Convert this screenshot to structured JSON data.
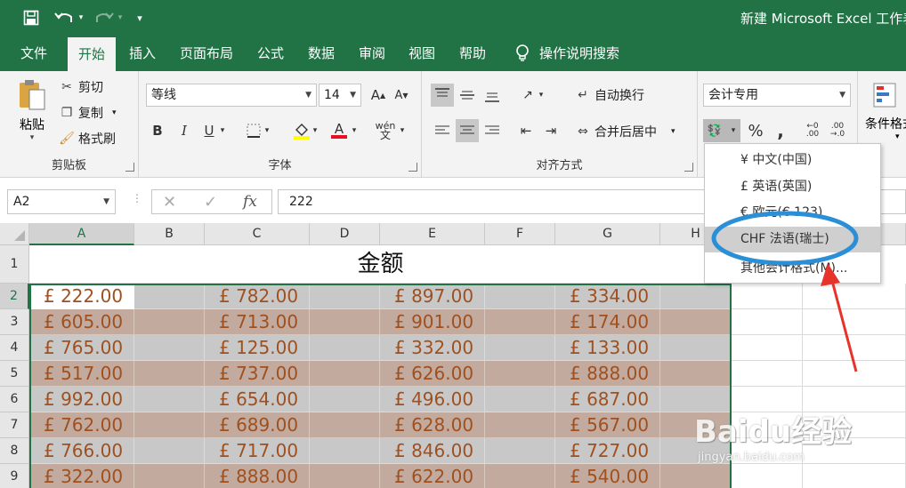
{
  "window": {
    "title": "新建 Microsoft Excel 工作表"
  },
  "quick_access": {
    "more": "▾"
  },
  "tabs": [
    {
      "label": "文件"
    },
    {
      "label": "开始"
    },
    {
      "label": "插入"
    },
    {
      "label": "页面布局"
    },
    {
      "label": "公式"
    },
    {
      "label": "数据"
    },
    {
      "label": "审阅"
    },
    {
      "label": "视图"
    },
    {
      "label": "帮助"
    },
    {
      "label": "操作说明搜索"
    }
  ],
  "ribbon": {
    "clipboard": {
      "label": "剪贴板",
      "paste": "粘贴",
      "cut": "剪切",
      "copy": "复制",
      "format_painter": "格式刷"
    },
    "font": {
      "label": "字体",
      "font_name": "等线",
      "font_size": "14",
      "increase": "A",
      "decrease": "A",
      "bold": "B",
      "italic": "I",
      "underline": "U",
      "phonetic": "wén"
    },
    "alignment": {
      "label": "对齐方式",
      "wrap_text": "自动换行",
      "merge_center": "合并后居中"
    },
    "number": {
      "format": "会计专用",
      "percent": "%",
      "comma": ","
    },
    "styles": {
      "conditional": "条件格式"
    }
  },
  "formula_bar": {
    "name_box": "A2",
    "fx": "fx",
    "value": "222"
  },
  "columns": [
    "A",
    "B",
    "C",
    "D",
    "E",
    "F",
    "G",
    "H"
  ],
  "rows": [
    "1",
    "2",
    "3",
    "4",
    "5",
    "6",
    "7",
    "8",
    "9"
  ],
  "sheet": {
    "title": "金额",
    "rows": [
      [
        "£ 222.00",
        "£ 782.00",
        "£ 897.00",
        "£ 334.00"
      ],
      [
        "£ 605.00",
        "£ 713.00",
        "£ 901.00",
        "£ 174.00"
      ],
      [
        "£ 765.00",
        "£ 125.00",
        "£ 332.00",
        "£ 133.00"
      ],
      [
        "£ 517.00",
        "£ 737.00",
        "£ 626.00",
        "£ 888.00"
      ],
      [
        "£ 992.00",
        "£ 654.00",
        "£ 496.00",
        "£ 687.00"
      ],
      [
        "£ 762.00",
        "£ 689.00",
        "£ 628.00",
        "£ 567.00"
      ],
      [
        "£ 766.00",
        "£ 717.00",
        "£ 846.00",
        "£ 727.00"
      ],
      [
        "£ 322.00",
        "£ 888.00",
        "£ 622.00",
        "£ 540.00"
      ]
    ]
  },
  "currency_menu": {
    "items": [
      "¥ 中文(中国)",
      "£ 英语(英国)",
      "€ 欧元(€ 123)",
      "CHF 法语(瑞士)",
      "其他会计格式(M)..."
    ]
  },
  "watermark": {
    "brand": "Baidu经验",
    "url": "jingyan.baidu.com"
  },
  "colors": {
    "brand_green": "#217346",
    "cell_text": "#a0501e",
    "band_tan": "#c2ab9e",
    "band_gray": "#c8c8c8",
    "callout_blue": "#2a8fd6",
    "arrow_red": "#e8332b"
  }
}
